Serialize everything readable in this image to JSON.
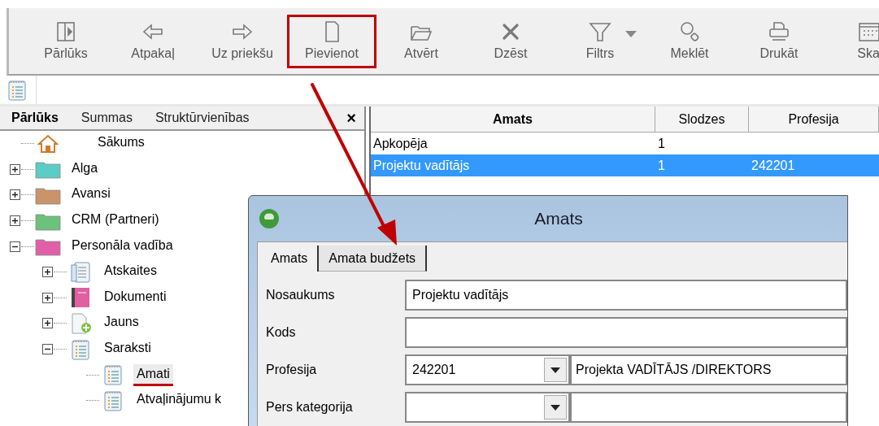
{
  "toolbar": {
    "items": [
      {
        "label": "Pārlūks",
        "kind": "browser",
        "highlighted": false
      },
      {
        "label": "Atpakaļ",
        "kind": "back",
        "highlighted": false
      },
      {
        "label": "Uz priekšu",
        "kind": "forward",
        "highlighted": false
      },
      {
        "label": "Pievienot",
        "kind": "new",
        "highlighted": true
      },
      {
        "label": "Atvērt",
        "kind": "open",
        "highlighted": false
      },
      {
        "label": "Dzēst",
        "kind": "delete",
        "highlighted": false
      },
      {
        "label": "Filtrs",
        "kind": "filter",
        "highlighted": false
      },
      {
        "label": "Meklēt",
        "kind": "search",
        "highlighted": false
      },
      {
        "label": "Drukāt",
        "kind": "print",
        "highlighted": false
      },
      {
        "label": "Ska",
        "kind": "calendar",
        "highlighted": false
      }
    ]
  },
  "browser_panel": {
    "tabs": [
      {
        "label": "Pārlūks",
        "selected": true
      },
      {
        "label": "Summas",
        "selected": false
      },
      {
        "label": "Struktūrvienības",
        "selected": false
      }
    ],
    "close": "×",
    "tree": [
      {
        "label": "Sākums",
        "kind": "home"
      },
      {
        "label": "Alga",
        "kind": "folder",
        "color": "#5ccdc4",
        "expanded": false
      },
      {
        "label": "Avansi",
        "kind": "folder",
        "color": "#c9946a",
        "expanded": false
      },
      {
        "label": "CRM (Partneri)",
        "kind": "folder",
        "color": "#6cc27a",
        "expanded": false
      },
      {
        "label": "Personāla vadība",
        "kind": "folder",
        "color": "#e060a8",
        "expanded": true,
        "children": [
          {
            "label": "Atskaites",
            "kind": "report",
            "expanded": false
          },
          {
            "label": "Dokumenti",
            "kind": "book",
            "expanded": false
          },
          {
            "label": "Jauns",
            "kind": "newdoc",
            "expanded": false
          },
          {
            "label": "Saraksti",
            "kind": "list",
            "expanded": true,
            "children": [
              {
                "label": "Amati",
                "kind": "list",
                "underlined": true
              },
              {
                "label": "Atvaļinājumu k",
                "kind": "list",
                "underlined": false
              }
            ]
          }
        ]
      }
    ]
  },
  "table": {
    "columns": [
      "Amats",
      "Slodzes",
      "Profesija"
    ],
    "rows": [
      {
        "cells": [
          "Apkopēja",
          "1",
          ""
        ],
        "selected": false
      },
      {
        "cells": [
          "Projektu vadītājs",
          "1",
          "242201"
        ],
        "selected": true
      }
    ]
  },
  "dialog": {
    "title": "Amats",
    "tabs": [
      {
        "label": "Amats",
        "selected": true
      },
      {
        "label": "Amata budžets",
        "selected": false
      }
    ],
    "fields": [
      {
        "label": "Nosaukums",
        "kind": "text",
        "value": "Projektu vadītājs"
      },
      {
        "label": "Kods",
        "kind": "text"
      },
      {
        "label": "Profesija",
        "kind": "lookup",
        "value": "242201",
        "description": "Projekta VADĪTĀJS /DIREKTORS"
      },
      {
        "label": "Pers kategorija",
        "kind": "lookup"
      }
    ]
  }
}
